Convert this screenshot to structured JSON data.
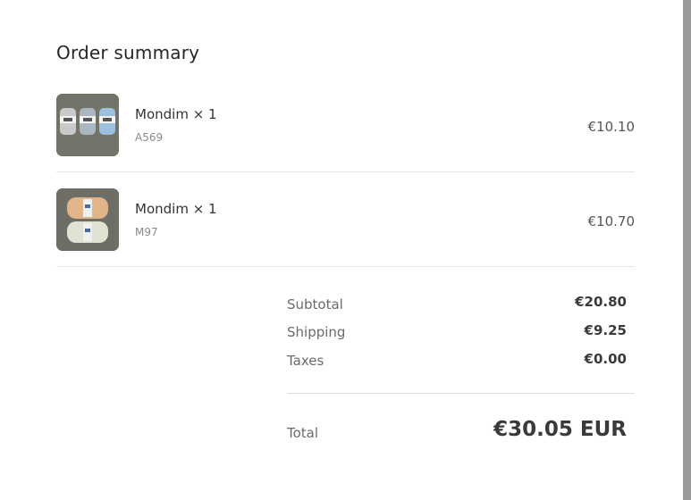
{
  "order_summary": {
    "title": "Order summary",
    "items": [
      {
        "name": "Mondim × 1",
        "sku": "A569",
        "price": "€10.10",
        "image_icon": "yarn-skeins-blue-grey-thumbnail"
      },
      {
        "name": "Mondim × 1",
        "sku": "M97",
        "price": "€10.70",
        "image_icon": "yarn-skeins-peach-mint-thumbnail"
      }
    ],
    "subtotal_label": "Subtotal",
    "subtotal_value": "€20.80",
    "shipping_label": "Shipping",
    "shipping_value": "€9.25",
    "taxes_label": "Taxes",
    "taxes_value": "€0.00",
    "total_label": "Total",
    "total_value": "€30.05 EUR"
  },
  "colors": {
    "text_primary": "#333333",
    "text_muted": "#8a8a8a",
    "divider": "#e6e6e6"
  }
}
